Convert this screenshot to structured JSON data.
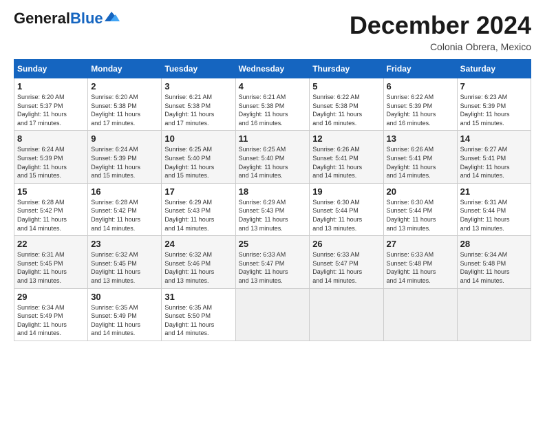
{
  "logo": {
    "general": "General",
    "blue": "Blue"
  },
  "title": "December 2024",
  "subtitle": "Colonia Obrera, Mexico",
  "weekdays": [
    "Sunday",
    "Monday",
    "Tuesday",
    "Wednesday",
    "Thursday",
    "Friday",
    "Saturday"
  ],
  "weeks": [
    [
      {
        "day": 1,
        "sunrise": "6:20 AM",
        "sunset": "5:37 PM",
        "daylight": "11 hours and 17 minutes."
      },
      {
        "day": 2,
        "sunrise": "6:20 AM",
        "sunset": "5:38 PM",
        "daylight": "11 hours and 17 minutes."
      },
      {
        "day": 3,
        "sunrise": "6:21 AM",
        "sunset": "5:38 PM",
        "daylight": "11 hours and 17 minutes."
      },
      {
        "day": 4,
        "sunrise": "6:21 AM",
        "sunset": "5:38 PM",
        "daylight": "11 hours and 16 minutes."
      },
      {
        "day": 5,
        "sunrise": "6:22 AM",
        "sunset": "5:38 PM",
        "daylight": "11 hours and 16 minutes."
      },
      {
        "day": 6,
        "sunrise": "6:22 AM",
        "sunset": "5:39 PM",
        "daylight": "11 hours and 16 minutes."
      },
      {
        "day": 7,
        "sunrise": "6:23 AM",
        "sunset": "5:39 PM",
        "daylight": "11 hours and 15 minutes."
      }
    ],
    [
      {
        "day": 8,
        "sunrise": "6:24 AM",
        "sunset": "5:39 PM",
        "daylight": "11 hours and 15 minutes."
      },
      {
        "day": 9,
        "sunrise": "6:24 AM",
        "sunset": "5:39 PM",
        "daylight": "11 hours and 15 minutes."
      },
      {
        "day": 10,
        "sunrise": "6:25 AM",
        "sunset": "5:40 PM",
        "daylight": "11 hours and 15 minutes."
      },
      {
        "day": 11,
        "sunrise": "6:25 AM",
        "sunset": "5:40 PM",
        "daylight": "11 hours and 14 minutes."
      },
      {
        "day": 12,
        "sunrise": "6:26 AM",
        "sunset": "5:41 PM",
        "daylight": "11 hours and 14 minutes."
      },
      {
        "day": 13,
        "sunrise": "6:26 AM",
        "sunset": "5:41 PM",
        "daylight": "11 hours and 14 minutes."
      },
      {
        "day": 14,
        "sunrise": "6:27 AM",
        "sunset": "5:41 PM",
        "daylight": "11 hours and 14 minutes."
      }
    ],
    [
      {
        "day": 15,
        "sunrise": "6:28 AM",
        "sunset": "5:42 PM",
        "daylight": "11 hours and 14 minutes."
      },
      {
        "day": 16,
        "sunrise": "6:28 AM",
        "sunset": "5:42 PM",
        "daylight": "11 hours and 14 minutes."
      },
      {
        "day": 17,
        "sunrise": "6:29 AM",
        "sunset": "5:43 PM",
        "daylight": "11 hours and 14 minutes."
      },
      {
        "day": 18,
        "sunrise": "6:29 AM",
        "sunset": "5:43 PM",
        "daylight": "11 hours and 13 minutes."
      },
      {
        "day": 19,
        "sunrise": "6:30 AM",
        "sunset": "5:44 PM",
        "daylight": "11 hours and 13 minutes."
      },
      {
        "day": 20,
        "sunrise": "6:30 AM",
        "sunset": "5:44 PM",
        "daylight": "11 hours and 13 minutes."
      },
      {
        "day": 21,
        "sunrise": "6:31 AM",
        "sunset": "5:44 PM",
        "daylight": "11 hours and 13 minutes."
      }
    ],
    [
      {
        "day": 22,
        "sunrise": "6:31 AM",
        "sunset": "5:45 PM",
        "daylight": "11 hours and 13 minutes."
      },
      {
        "day": 23,
        "sunrise": "6:32 AM",
        "sunset": "5:45 PM",
        "daylight": "11 hours and 13 minutes."
      },
      {
        "day": 24,
        "sunrise": "6:32 AM",
        "sunset": "5:46 PM",
        "daylight": "11 hours and 13 minutes."
      },
      {
        "day": 25,
        "sunrise": "6:33 AM",
        "sunset": "5:47 PM",
        "daylight": "11 hours and 13 minutes."
      },
      {
        "day": 26,
        "sunrise": "6:33 AM",
        "sunset": "5:47 PM",
        "daylight": "11 hours and 14 minutes."
      },
      {
        "day": 27,
        "sunrise": "6:33 AM",
        "sunset": "5:48 PM",
        "daylight": "11 hours and 14 minutes."
      },
      {
        "day": 28,
        "sunrise": "6:34 AM",
        "sunset": "5:48 PM",
        "daylight": "11 hours and 14 minutes."
      }
    ],
    [
      {
        "day": 29,
        "sunrise": "6:34 AM",
        "sunset": "5:49 PM",
        "daylight": "11 hours and 14 minutes."
      },
      {
        "day": 30,
        "sunrise": "6:35 AM",
        "sunset": "5:49 PM",
        "daylight": "11 hours and 14 minutes."
      },
      {
        "day": 31,
        "sunrise": "6:35 AM",
        "sunset": "5:50 PM",
        "daylight": "11 hours and 14 minutes."
      },
      null,
      null,
      null,
      null
    ]
  ],
  "labels": {
    "sunrise": "Sunrise:",
    "sunset": "Sunset:",
    "daylight": "Daylight:"
  }
}
